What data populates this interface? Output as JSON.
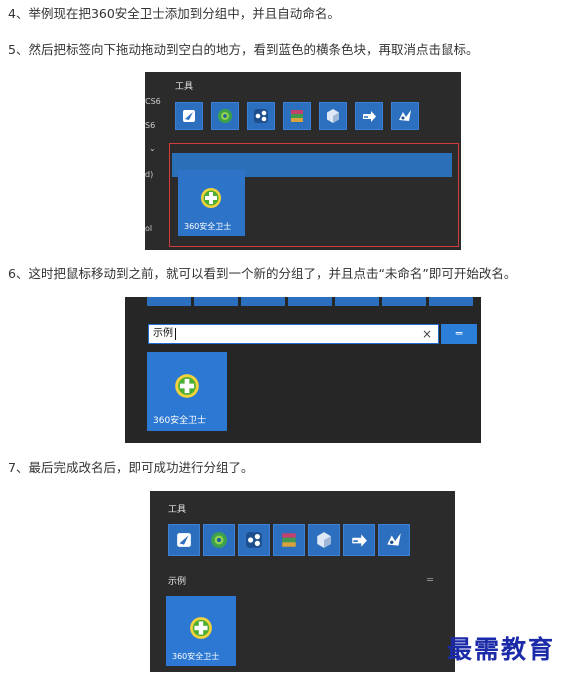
{
  "steps": [
    "4、举例现在把360安全卫士添加到分组中，并且自动命名。",
    "5、然后把标签向下拖动拖动到空白的地方，看到蓝色的横条色块，再取消点击鼠标。",
    "6、这时把鼠标移动到之前，就可以看到一个新的分组了，并且点击“未命名”即可开始改名。",
    "7、最后完成改名后，即可成功进行分组了。"
  ],
  "shot1": {
    "group_label": "工具",
    "side_labels": [
      "CS6",
      "S6",
      "⌄",
      "d)",
      "ol"
    ],
    "tile_icons": [
      "paper-plane-icon",
      "globe-icon",
      "share-icon",
      "archive-icon",
      "cube-icon",
      "arrow-icon",
      "bird-icon"
    ],
    "app_name": "360安全卫士",
    "highlight_color": "#d23c3c"
  },
  "shot2": {
    "name_input_value": "示例",
    "clear_symbol": "×",
    "menu_symbol": "═",
    "app_name": "360安全卫士"
  },
  "shot3": {
    "group_label": "工具",
    "new_group_label": "示例",
    "group_menu_symbol": "═",
    "tile_icons": [
      "paper-plane-icon",
      "globe-icon",
      "share-icon",
      "archive-icon",
      "cube-icon",
      "arrow-icon",
      "bird-icon"
    ],
    "app_name": "360安全卫士"
  },
  "watermark": "最需教育"
}
